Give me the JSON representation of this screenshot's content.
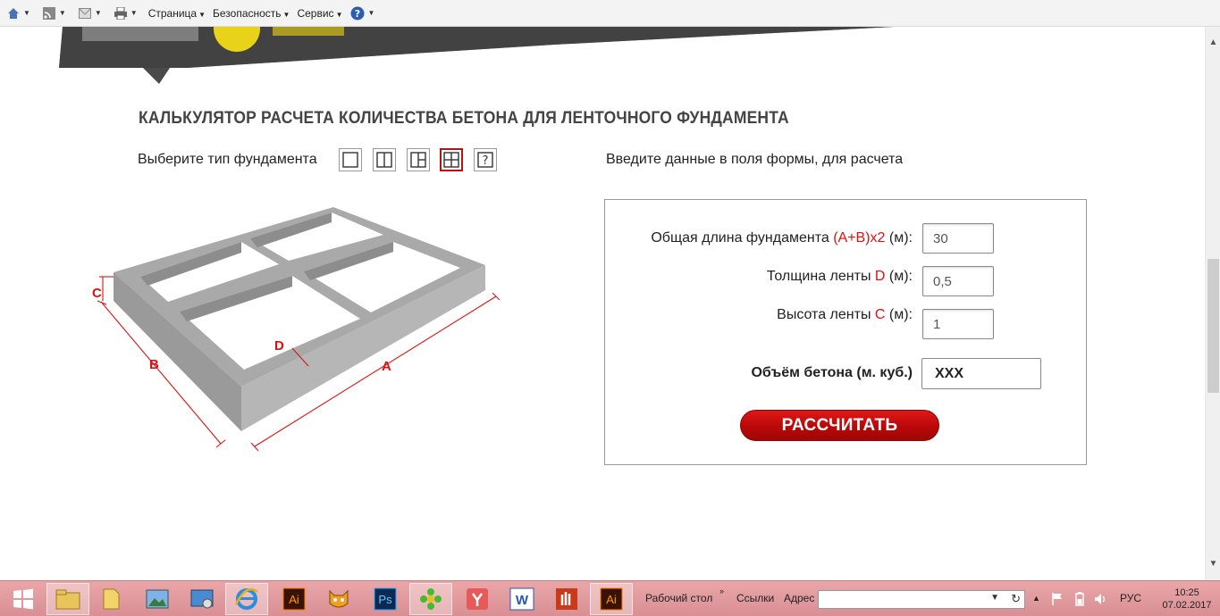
{
  "toolbar": {
    "menus": [
      "Страница",
      "Безопасность",
      "Сервис"
    ]
  },
  "page": {
    "title": "КАЛЬКУЛЯТОР РАСЧЕТА КОЛИЧЕСТВА БЕТОНА ДЛЯ ЛЕНТОЧНОГО ФУНДАМЕНТА",
    "type_label": "Выберите тип фундамента",
    "type_help": "?",
    "form_intro": "Введите данные в поля формы, для расчета"
  },
  "diagram": {
    "labels": {
      "a": "A",
      "b": "B",
      "c": "C",
      "d": "D"
    }
  },
  "form": {
    "length": {
      "label_pre": "Общая длина фундамента ",
      "label_red": "(A+B)x2",
      "label_post": " (м):",
      "value": "30"
    },
    "thickness": {
      "label_pre": "Толщина ленты ",
      "label_red": "D",
      "label_post": " (м):",
      "value": "0,5"
    },
    "height": {
      "label_pre": "Высота ленты ",
      "label_red": "C",
      "label_post": " (м):",
      "value": "1"
    },
    "result_label": "Объём бетона (м. куб.)",
    "result_value": "XXX",
    "calculate_label": "РАССЧИТАТЬ"
  },
  "taskbar": {
    "desktop_label": "Рабочий стол",
    "links_label": "Ссылки",
    "address_label": "Адрес",
    "lang": "РУС",
    "time": "10:25",
    "date": "07.02.2017",
    "app_ai_1": "Ai",
    "app_ps": "Ps",
    "app_ai_2": "Ai"
  },
  "colors": {
    "accent_red": "#e01010",
    "button_red": "#c00a0a",
    "taskbar": "#e09a9e"
  }
}
